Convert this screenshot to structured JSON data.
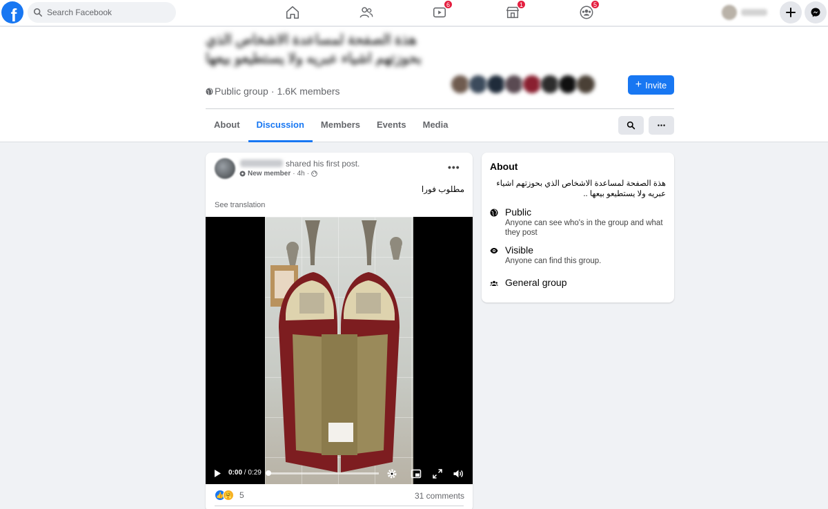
{
  "topnav": {
    "search_placeholder": "Search Facebook",
    "badges": {
      "watch": "6",
      "marketplace": "1",
      "groups": "5"
    },
    "accent": "#1877f2"
  },
  "group": {
    "title": "هذة الصفحة لمساعدة الاشخاص الذي بحوزتهم اشياء عبريه ولا يستطيعو بيعها",
    "privacy": "Public group",
    "separator": "·",
    "members": "1.6K members",
    "invite_label": "Invite",
    "tabs": [
      "About",
      "Discussion",
      "Members",
      "Events",
      "Media"
    ],
    "active_tab": "Discussion"
  },
  "post": {
    "shared_text": "shared his first post.",
    "badge": "New member",
    "time": "4h",
    "time_sep": "·",
    "text": "مطلوب فورا",
    "see_translation": "See translation",
    "video": {
      "current": "0:00",
      "duration": "0:29",
      "sep": "/"
    },
    "reaction_count": "5",
    "comments": "31 comments"
  },
  "about": {
    "title": "About",
    "description": "هذة الصفحة لمساعدة الاشخاص الذي بحوزتهم اشياء عبريه ولا يستطيعو بيعها ..",
    "items": [
      {
        "icon": "globe-icon",
        "title": "Public",
        "desc": "Anyone can see who's in the group and what they post"
      },
      {
        "icon": "eye-icon",
        "title": "Visible",
        "desc": "Anyone can find this group."
      },
      {
        "icon": "people-icon",
        "title": "General group",
        "desc": ""
      }
    ]
  }
}
